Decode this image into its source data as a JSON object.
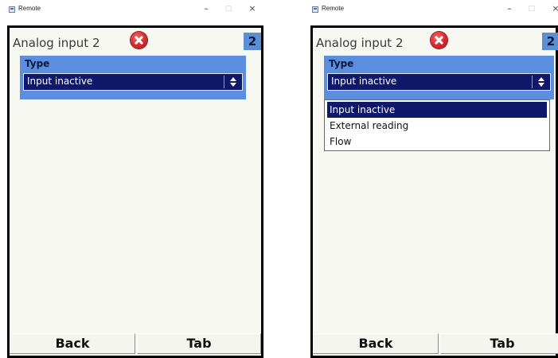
{
  "windows": [
    {
      "title": "Remote",
      "controls": {
        "minimize": "–",
        "maximize": "□",
        "close": "×"
      },
      "page_title": "Analog input 2",
      "page_number": "2",
      "group_label": "Type",
      "select_value": "Input inactive",
      "dropdown_open": false,
      "footer": {
        "back": "Back",
        "tab": "Tab"
      }
    },
    {
      "title": "Remote",
      "controls": {
        "minimize": "–",
        "maximize": "□",
        "close": "×"
      },
      "page_title": "Analog input 2",
      "page_number": "2",
      "group_label": "Type",
      "select_value": "Input inactive",
      "dropdown_open": true,
      "options": [
        "Input inactive",
        "External reading",
        "Flow"
      ],
      "selected_option": "Input inactive",
      "footer": {
        "back": "Back",
        "tab": "Tab"
      }
    }
  ],
  "colors": {
    "group_bg": "#5c8ee0",
    "select_bg": "#10186a",
    "page_number_bg": "#5a8fd4",
    "error_icon": "#d8262c"
  }
}
